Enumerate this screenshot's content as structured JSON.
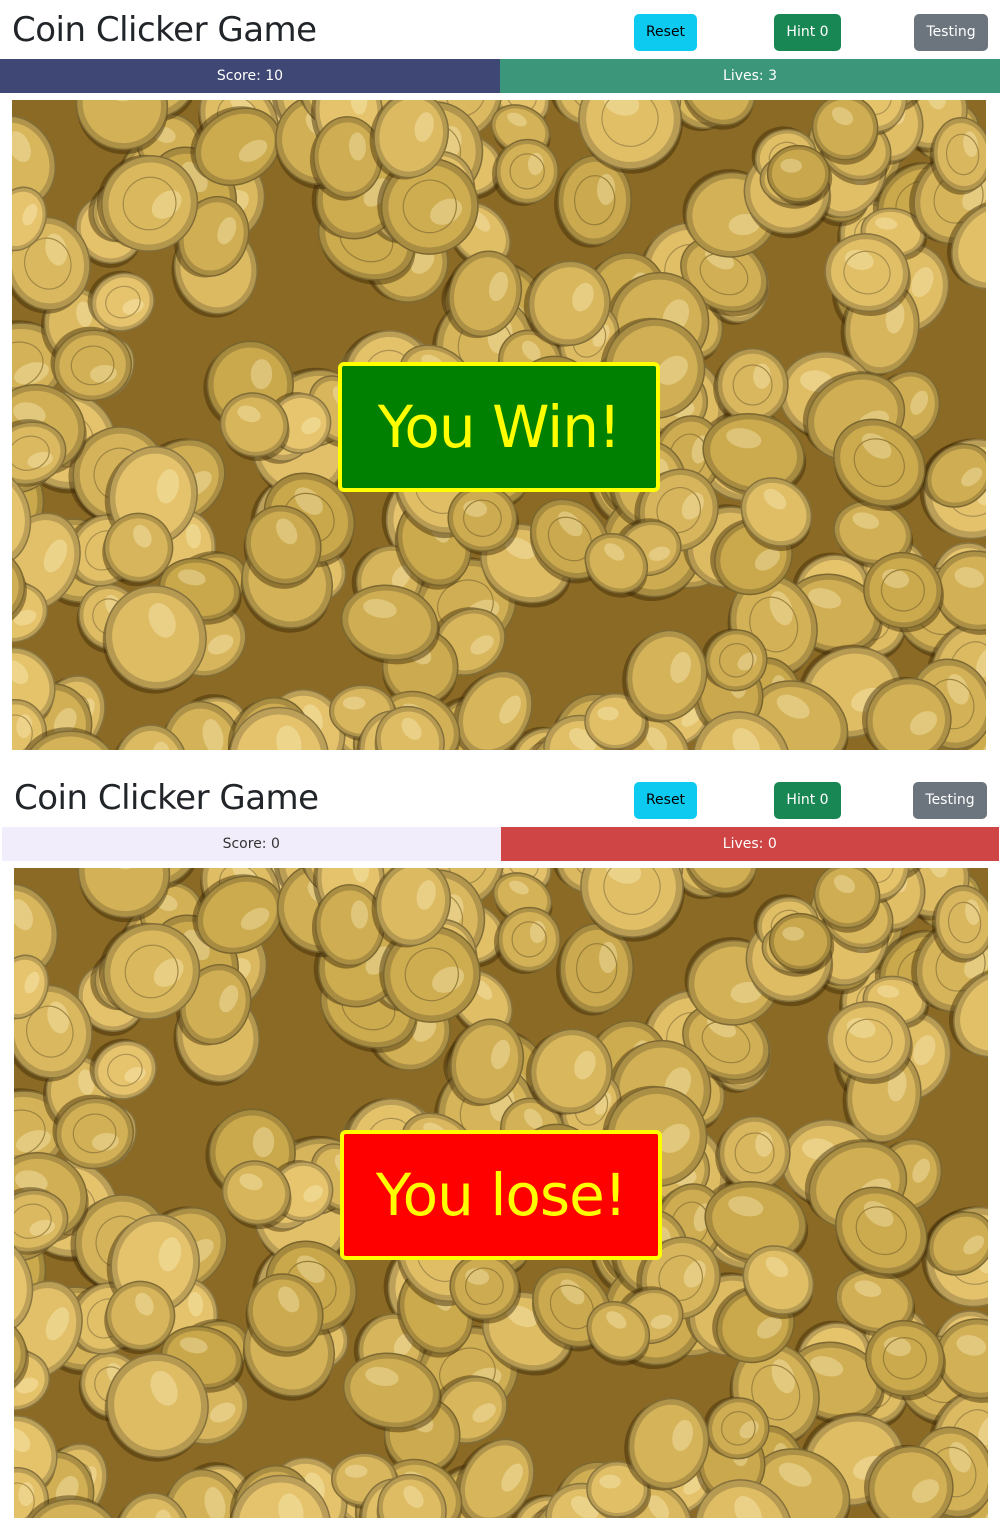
{
  "colors": {
    "score_win_bg": "#3f4775",
    "lives_win_bg": "#3c9679",
    "score_lose_bg": "#f1edfb",
    "lives_lose_bg": "#cf4545",
    "win_box_bg": "#008000",
    "lose_box_bg": "#ff0000",
    "box_text": "#ffff00",
    "coin_base": "#c9a74b"
  },
  "screens": [
    {
      "title": "Coin Clicker Game",
      "buttons": {
        "reset": "Reset",
        "hint": "Hint 0",
        "testing": "Testing"
      },
      "score": "Score: 10",
      "lives": "Lives: 3",
      "result": "You Win!"
    },
    {
      "title": "Coin Clicker Game",
      "buttons": {
        "reset": "Reset",
        "hint": "Hint 0",
        "testing": "Testing"
      },
      "score": "Score: 0",
      "lives": "Lives: 0",
      "result": "You lose!"
    }
  ],
  "icons": {
    "coin_pile": "coin-pile-image"
  }
}
